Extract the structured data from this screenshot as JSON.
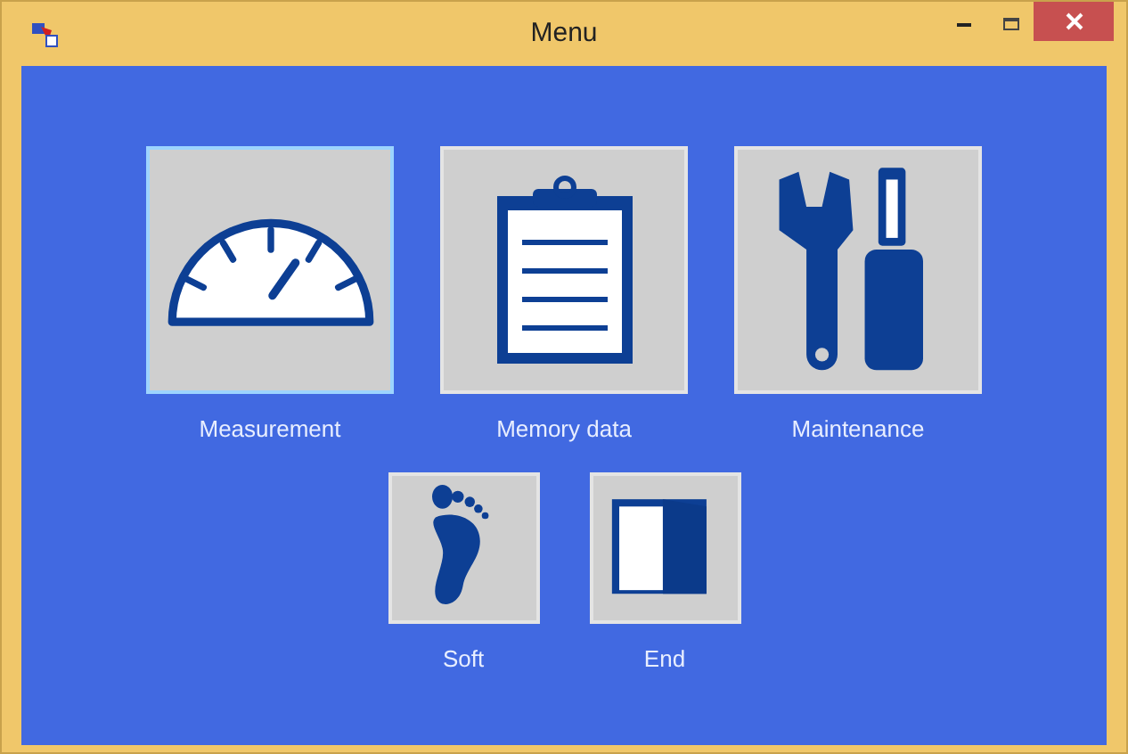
{
  "window": {
    "title": "Menu"
  },
  "rows": [
    [
      {
        "label": "Measurement",
        "kind": "gauge",
        "selected": true
      },
      {
        "label": "Memory data",
        "kind": "clipboard",
        "selected": false
      },
      {
        "label": "Maintenance",
        "kind": "tools",
        "selected": false
      }
    ],
    [
      {
        "label": "Soft",
        "kind": "foot",
        "selected": false
      },
      {
        "label": "End",
        "kind": "door",
        "selected": false
      }
    ]
  ]
}
